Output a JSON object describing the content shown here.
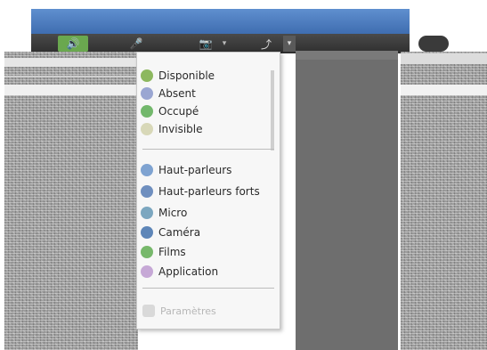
{
  "menu": {
    "groups": [
      {
        "items": [
          {
            "label": "Disponible",
            "icon": "available-icon",
            "color": "#8db85f"
          },
          {
            "label": "Absent",
            "icon": "away-icon",
            "color": "#9aa6d2"
          },
          {
            "label": "Occupé",
            "icon": "busy-icon",
            "color": "#73b86c"
          },
          {
            "label": "Invisible",
            "icon": "invisible-icon",
            "color": "#d8d8b8"
          }
        ]
      },
      {
        "items": [
          {
            "label": "Haut-parleurs",
            "icon": "speaker-icon",
            "color": "#7fa3d1"
          },
          {
            "label": "Haut-parleurs forts",
            "icon": "speaker-loud-icon",
            "color": "#6f8fbf"
          },
          {
            "label": "Micro",
            "icon": "microphone-icon",
            "color": "#7ca7c0"
          },
          {
            "label": "Caméra",
            "icon": "camera-icon",
            "color": "#5e86b8"
          },
          {
            "label": "Films",
            "icon": "films-icon",
            "color": "#77b86b"
          },
          {
            "label": "Application",
            "icon": "application-icon",
            "color": "#c6a8d6"
          }
        ]
      }
    ],
    "footer_label": "Paramètres"
  },
  "toolbar": {
    "speaker_icon": "speaker-icon",
    "mic_icon": "microphone-icon",
    "camera_icon": "camera-icon",
    "share_icon": "share-icon"
  }
}
